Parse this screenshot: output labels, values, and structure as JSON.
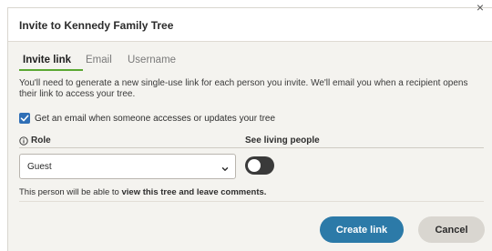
{
  "dialog": {
    "title": "Invite to Kennedy Family Tree",
    "close_glyph": "×"
  },
  "tabs": [
    {
      "label": "Invite link",
      "active": true
    },
    {
      "label": "Email",
      "active": false
    },
    {
      "label": "Username",
      "active": false
    }
  ],
  "description": "You'll need to generate a new single-use link for each person you invite. We'll email you when a recipient opens their link to access your tree.",
  "notify_checkbox": {
    "label": "Get an email when someone accesses or updates your tree",
    "checked": true
  },
  "role": {
    "label": "Role",
    "selected": "Guest"
  },
  "living": {
    "label": "See living people",
    "enabled": false
  },
  "permission_note": {
    "prefix": "This person will be able to ",
    "emphasis": "view this tree and leave comments."
  },
  "buttons": {
    "create": "Create link",
    "cancel": "Cancel"
  },
  "colors": {
    "accent_green": "#5aa832",
    "primary_button": "#2c7aa8",
    "checkbox": "#2f6fb6"
  }
}
